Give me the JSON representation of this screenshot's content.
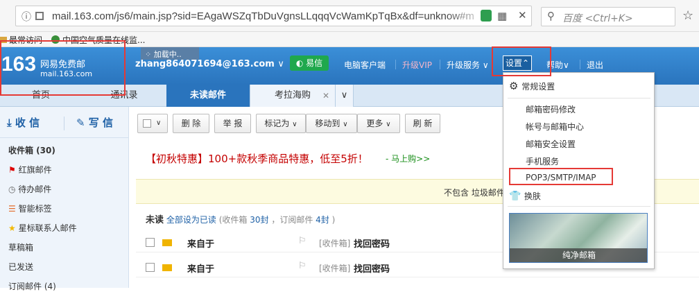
{
  "browser": {
    "url": "mail.163.com/js6/main.jsp?sid=EAgaWSZqTbDuVgnsLLqqqVcWamKpTqBx&df=unknow#m",
    "search_placeholder": "百度 <Ctrl+K>",
    "close_glyph": "✕"
  },
  "bookmarks": [
    "最常访问",
    "中国空气质量在线监..."
  ],
  "header": {
    "logo_number": "163",
    "logo_title": "网易免费邮",
    "logo_domain": "mail.163.com",
    "loading": "加载中..",
    "user": "zhang864071694@163.com",
    "yixin": "易信",
    "links": [
      "电脑客户端",
      "升级VIP",
      "升级服务",
      "设置",
      "帮助",
      "退出"
    ]
  },
  "tabs": [
    "首页",
    "通讯录",
    "未读邮件",
    "考拉海购"
  ],
  "sidebar": {
    "receive": "收 信",
    "write": "写 信",
    "items": [
      "收件箱 (30)",
      "红旗邮件",
      "待办邮件",
      "智能标签",
      "星标联系人邮件",
      "草稿箱",
      "已发送",
      "订阅邮件 (4)"
    ]
  },
  "toolbar": [
    "删 除",
    "举 报",
    "标记为",
    "移动到",
    "更多",
    "刷 新"
  ],
  "promo": {
    "text": "【初秋特惠】100+款秋季商品特惠，低至5折！",
    "link": "- 马上购>>"
  },
  "notice": "不包含 垃圾邮件",
  "unread": {
    "label": "未读",
    "mark_all": "全部设为已读",
    "stats_prefix": "(收件箱",
    "inbox_count": "30封",
    "stats_mid": "，订阅邮件",
    "sub_count": "4封",
    "stats_suffix": ")"
  },
  "mails": [
    {
      "sender": "来自于",
      "folder": "[收件箱]",
      "subject": "找回密码"
    },
    {
      "sender": "来自于",
      "folder": "[收件箱]",
      "subject": "找回密码"
    }
  ],
  "dropdown": {
    "general": "常规设置",
    "items": [
      "邮箱密码修改",
      "帐号与邮箱中心",
      "邮箱安全设置",
      "手机服务",
      "POP3/SMTP/IMAP"
    ],
    "skin": "换肤",
    "theme": "纯净邮箱"
  },
  "colors": {
    "accent": "#2a74bd",
    "highlight_red": "#e53935",
    "yixin_green": "#1fa84d"
  }
}
